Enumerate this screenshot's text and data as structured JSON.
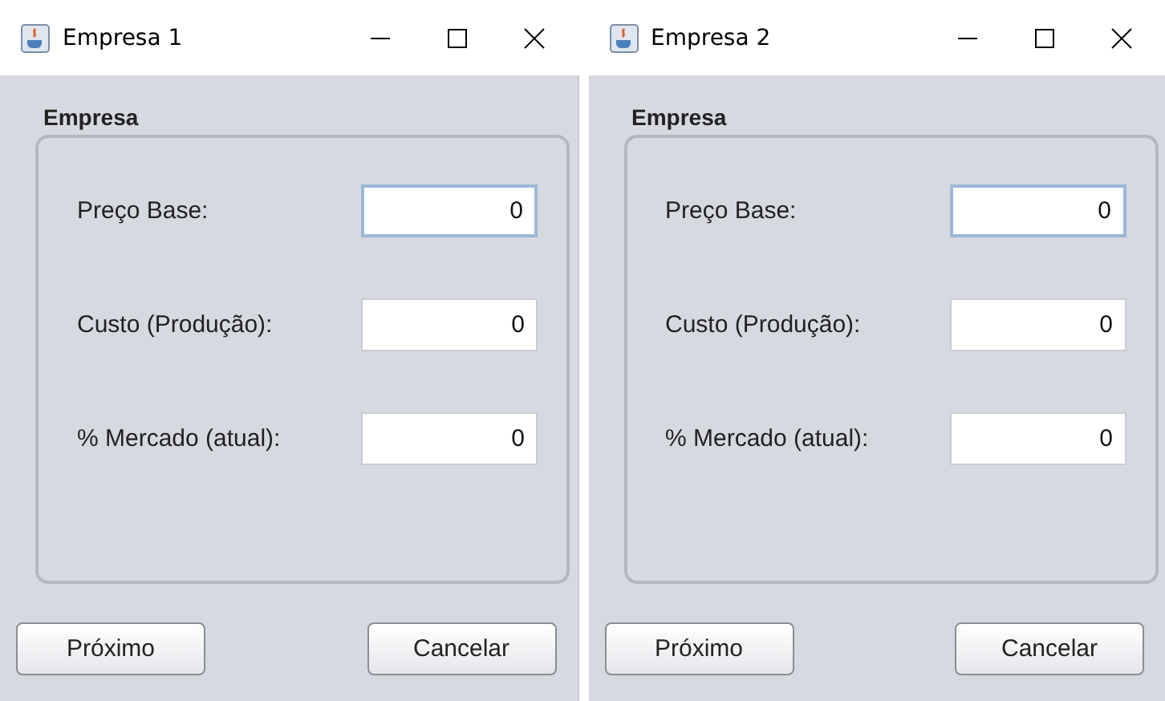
{
  "windows": [
    {
      "title": "Empresa 1",
      "group_title": "Empresa",
      "fields": [
        {
          "label": "Preço Base:",
          "value": "0",
          "focused": true
        },
        {
          "label": "Custo (Produção):",
          "value": "0",
          "focused": false
        },
        {
          "label": "% Mercado (atual):",
          "value": "0",
          "focused": false
        }
      ],
      "buttons": [
        "Próximo",
        "Cancelar"
      ]
    },
    {
      "title": "Empresa 2",
      "group_title": "Empresa",
      "fields": [
        {
          "label": "Preço Base:",
          "value": "0",
          "focused": true
        },
        {
          "label": "Custo (Produção):",
          "value": "0",
          "focused": false
        },
        {
          "label": "% Mercado (atual):",
          "value": "0",
          "focused": false
        }
      ],
      "buttons": [
        "Próximo",
        "Cancelar"
      ]
    }
  ]
}
